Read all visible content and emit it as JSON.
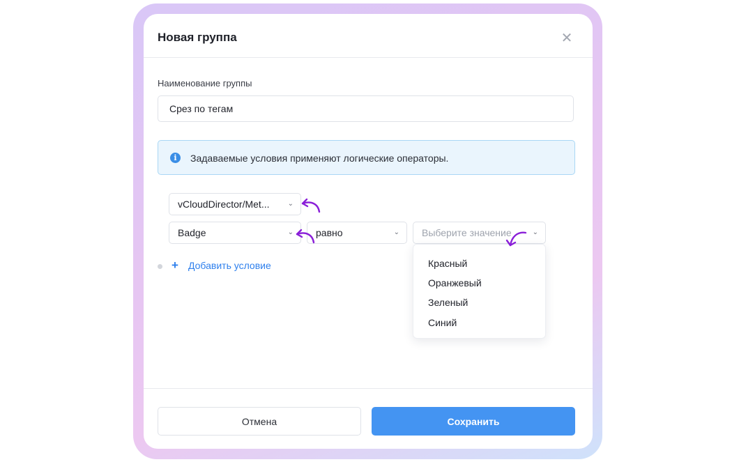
{
  "dialog": {
    "title": "Новая группа",
    "close_icon": "close-icon"
  },
  "form": {
    "group_name_label": "Наименование группы",
    "group_name_value": "Срез по тегам",
    "info_text": "Задаваемые условия применяют логические операторы.",
    "info_icon": "info-icon"
  },
  "conditions": {
    "source_select": "vCloudDirector/Met...",
    "field_select": "Badge",
    "operator_select": "равно",
    "value_placeholder": "Выберите значение",
    "value_options": [
      "Красный",
      "Оранжевый",
      "Зеленый",
      "Синий"
    ],
    "add_condition_label": "Добавить условие",
    "add_icon": "plus-icon"
  },
  "footer": {
    "cancel_label": "Отмена",
    "save_label": "Сохранить"
  },
  "colors": {
    "accent": "#4494f2",
    "link": "#2f80ed",
    "annotation_arrow": "#8a1fd8",
    "info_background": "#eaf5fd"
  }
}
